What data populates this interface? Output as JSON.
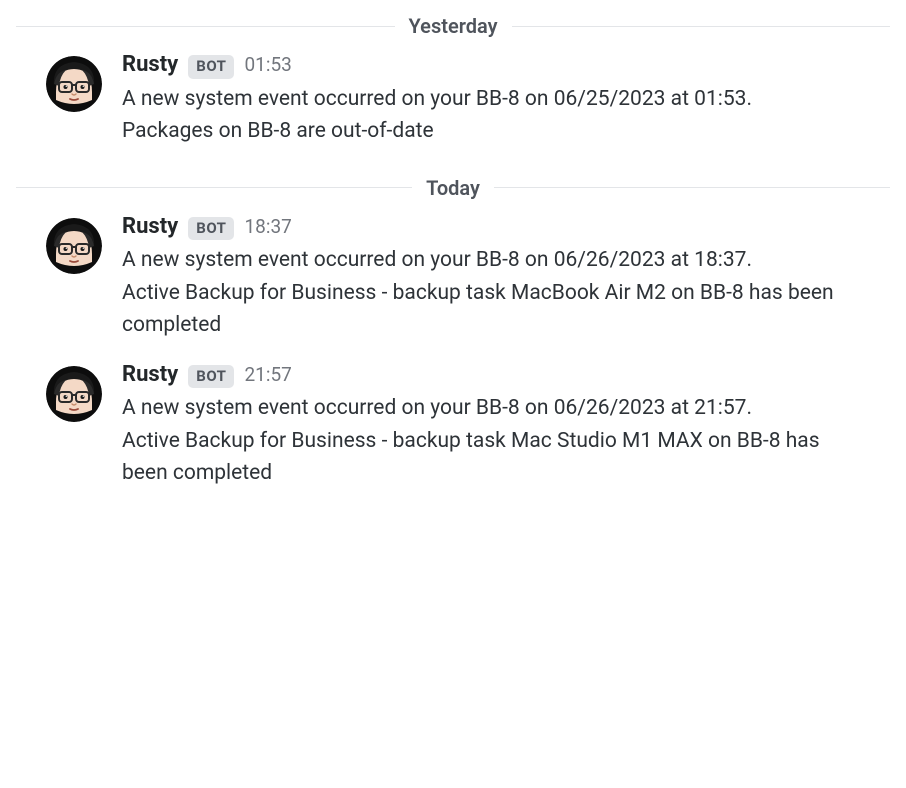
{
  "dividers": {
    "yesterday": "Yesterday",
    "today": "Today"
  },
  "bot_badge": "BOT",
  "messages": [
    {
      "author": "Rusty",
      "time": "01:53",
      "line1": "A new system event occurred on your BB-8 on 06/25/2023 at 01:53.",
      "line2": "Packages on BB-8 are out-of-date"
    },
    {
      "author": "Rusty",
      "time": "18:37",
      "line1": "A new system event occurred on your BB-8 on 06/26/2023 at 18:37.",
      "line2": "Active Backup for Business - backup task MacBook Air M2 on BB-8 has been completed"
    },
    {
      "author": "Rusty",
      "time": "21:57",
      "line1": "A new system event occurred on your BB-8 on 06/26/2023 at 21:57.",
      "line2": "Active Backup for Business - backup task Mac Studio M1 MAX on BB-8 has been completed"
    }
  ]
}
